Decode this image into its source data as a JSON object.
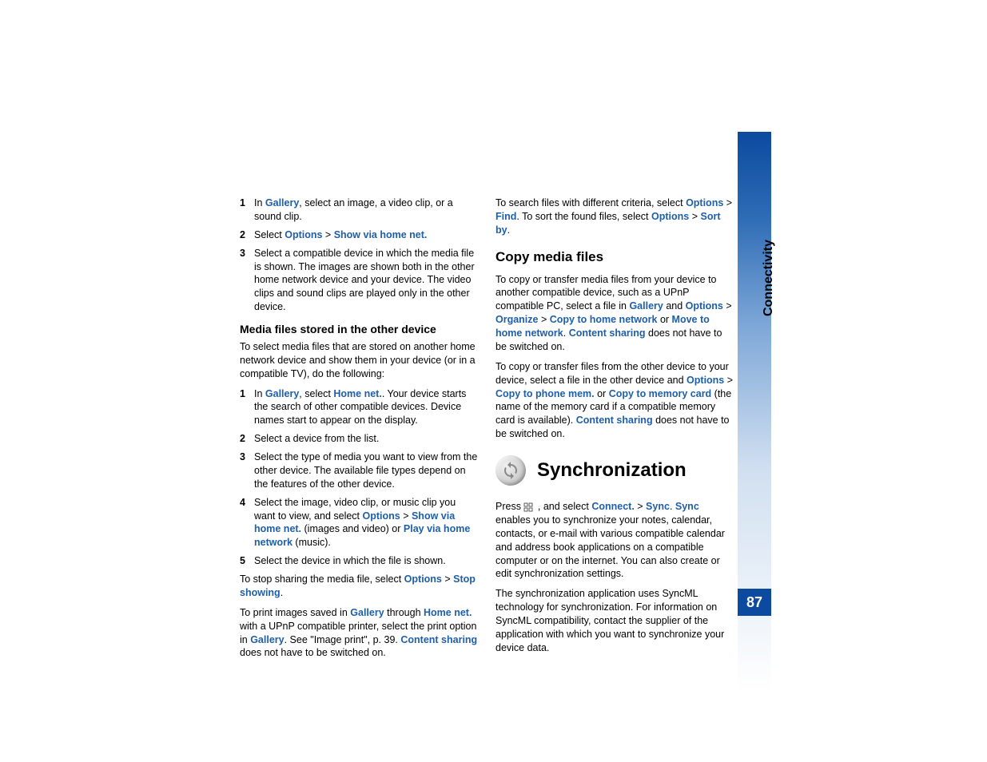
{
  "chapter": "Connectivity",
  "pageNumber": "87",
  "col1": {
    "step1": {
      "n": "1",
      "pre": "In ",
      "l1": "Gallery",
      "post": ", select an image, a video clip, or a sound clip."
    },
    "step2": {
      "n": "2",
      "pre": "Select ",
      "l1": "Options",
      "gt": " > ",
      "l2": "Show via home net.",
      "post": ""
    },
    "step3": {
      "n": "3",
      "text": "Select a compatible device in which the media file is shown. The images are shown both in the other home network device and your device. The video clips and sound clips are played only in the other device."
    },
    "h3": "Media files stored in the other device",
    "p1": "To select media files that are stored on another home network device and show them in your device (or in a compatible TV), do the following:",
    "b1": {
      "n": "1",
      "pre": "In ",
      "l1": "Gallery",
      "mid": ", select ",
      "l2": "Home net.",
      "post": ". Your device starts the search of other compatible devices. Device names start to appear on the display."
    },
    "b2": {
      "n": "2",
      "text": "Select a device from the list."
    },
    "b3": {
      "n": "3",
      "text": "Select the type of media you want to view from the other device. The available file types depend on the features of the other device."
    },
    "b4": {
      "n": "4",
      "pre": "Select the image, video clip, or music clip you want to view, and select ",
      "l1": "Options",
      "gt": " > ",
      "l2": "Show via home net.",
      "mid": " (images and video) or ",
      "l3": "Play via home network",
      "post": " (music)."
    },
    "b5": {
      "n": "5",
      "text": "Select the device in which the file is shown."
    },
    "p2": {
      "pre": "To stop sharing the media file, select ",
      "l1": "Options",
      "gt": " > ",
      "l2": "Stop showing",
      "post": "."
    },
    "p3": {
      "pre": "To print images saved in ",
      "l1": "Gallery",
      "mid1": " through ",
      "l2": "Home net.",
      "mid2": " with a UPnP compatible printer, select the print option in ",
      "l3": "Gallery",
      "mid3": ". See \"Image print\", p. 39. ",
      "l4": "Content sharing",
      "post": " does not have to be switched on."
    }
  },
  "col2": {
    "p1": {
      "pre": "To search files with different criteria, select ",
      "l1": "Options",
      "gt": " > ",
      "l2": "Find",
      "mid": ". To sort the found files, select ",
      "l3": "Options",
      "gt2": " > ",
      "l4": "Sort by",
      "post": "."
    },
    "h2": "Copy media files",
    "p2": {
      "pre": "To copy or transfer media files from your device to another compatible device, such as a UPnP compatible PC, select a file in ",
      "l1": "Gallery",
      "mid1": " and ",
      "l2": "Options",
      "gt": " > ",
      "l3": "Organize",
      "gt2": " > ",
      "l4": "Copy to home network",
      "mid2": " or ",
      "l5": "Move to home network",
      "mid3": ". ",
      "l6": "Content sharing",
      "post": " does not have to be switched on."
    },
    "p3": {
      "pre": "To copy or transfer files from the other device to your device, select a file in the other device and ",
      "l1": "Options",
      "gt": " > ",
      "l2": "Copy to phone mem.",
      "mid1": " or ",
      "l3": "Copy to memory card",
      "mid2": " (the name of the memory card if a compatible memory card is available). ",
      "l4": "Content sharing",
      "post": " does not have to be switched on."
    },
    "h1": "Synchronization",
    "p4": {
      "pre": "Press  ",
      "mid1": " , and select ",
      "l1": "Connect.",
      "gt": " > ",
      "l2": "Sync",
      "mid2": ". ",
      "l3": "Sync",
      "post": " enables you to synchronize your notes, calendar, contacts, or e-mail with various compatible calendar and address book applications on a compatible computer or on the internet. You can also create or edit synchronization settings."
    },
    "p5": "The synchronization application uses SyncML technology for synchronization. For information on SyncML compatibility, contact the supplier of the application with which you want to synchronize your device data."
  }
}
